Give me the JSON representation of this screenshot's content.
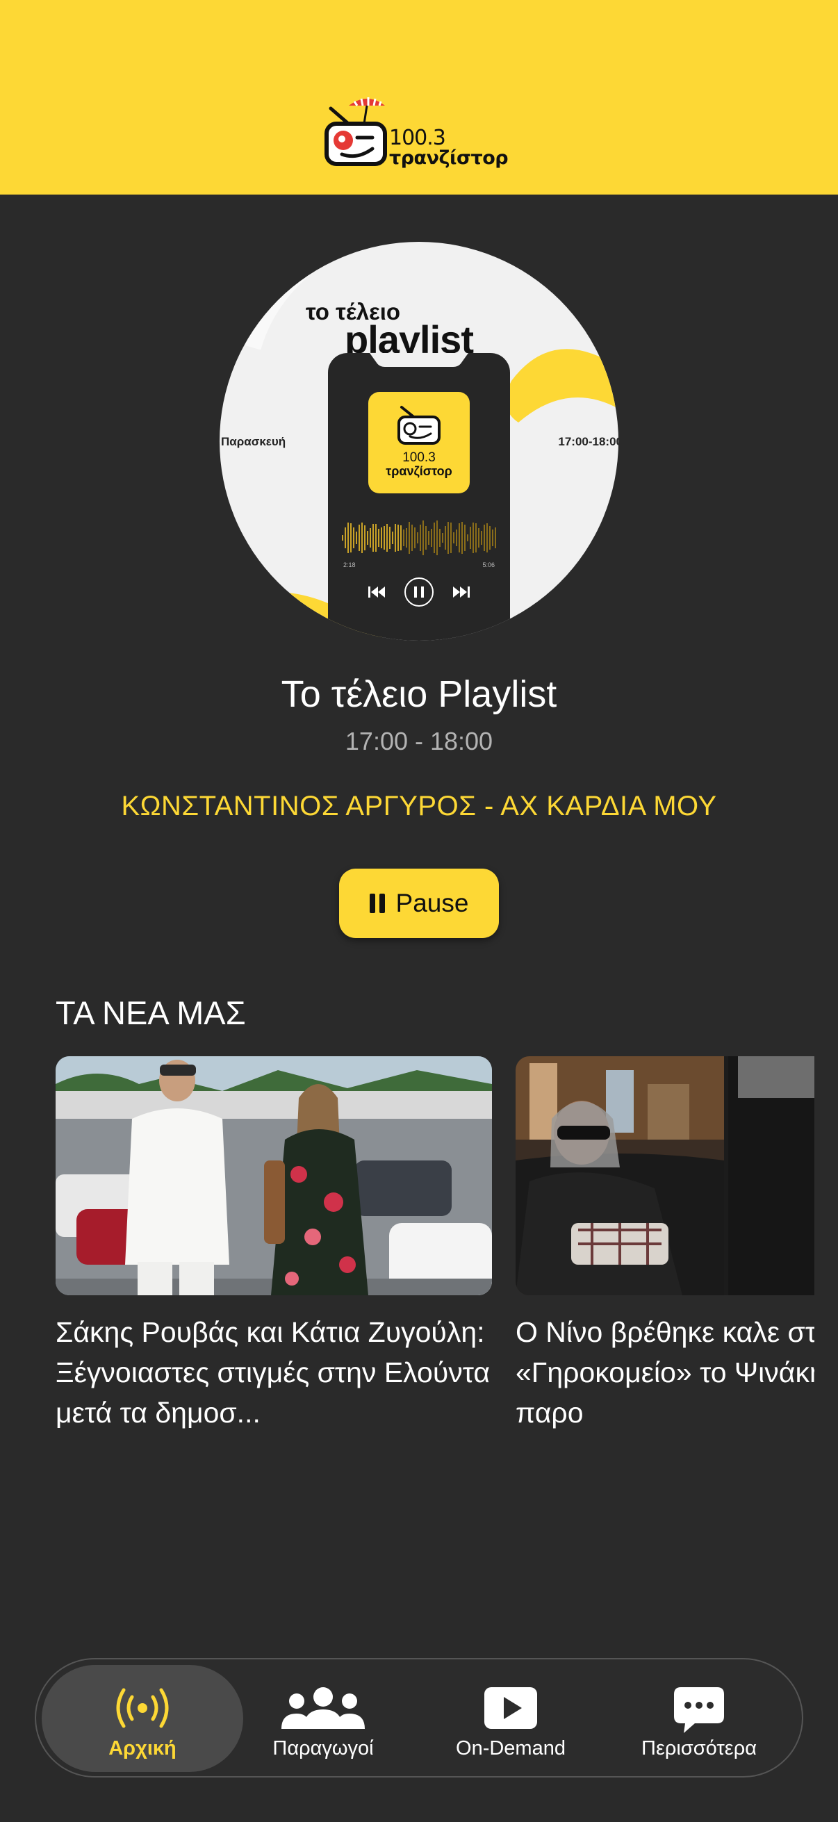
{
  "app": {
    "brand_frequency": "100.3",
    "brand_name": "τρανζίστορ",
    "accent_color": "#fdd835",
    "background_color": "#2a2a2a"
  },
  "artwork": {
    "heading_small": "το τέλειο",
    "heading_large": "playlist",
    "day": "Παρασκευή",
    "time": "17:00-18:00",
    "player_elapsed": "2:18",
    "player_remaining": "5:06"
  },
  "now_playing": {
    "show_title": "Το τέλειο Playlist",
    "show_time": "17:00 - 18:00",
    "track": "ΚΩΝΣΤΑΝΤΙΝΟΣ ΑΡΓΥΡΟΣ - ΑΧ ΚΑΡΔΙΑ ΜΟΥ",
    "pause_label": "Pause"
  },
  "news": {
    "heading": "ΤΑ ΝΕΑ ΜΑΣ",
    "items": [
      {
        "text": "Σάκης Ρουβάς και Κάτια Ζυγούλη: Ξέγνοιαστες στιγμές στην Ελούντα μετά τα δημοσ..."
      },
      {
        "text": "Ο Νίνο βρέθηκε καλε στο «Γηροκομείο» το Ψινάκη, με τον παρο"
      }
    ]
  },
  "nav": {
    "items": [
      {
        "label": "Αρχική",
        "icon": "broadcast-icon",
        "active": true
      },
      {
        "label": "Παραγωγοί",
        "icon": "users-icon",
        "active": false
      },
      {
        "label": "On-Demand",
        "icon": "play-icon",
        "active": false
      },
      {
        "label": "Περισσότερα",
        "icon": "chat-icon",
        "active": false
      }
    ]
  }
}
